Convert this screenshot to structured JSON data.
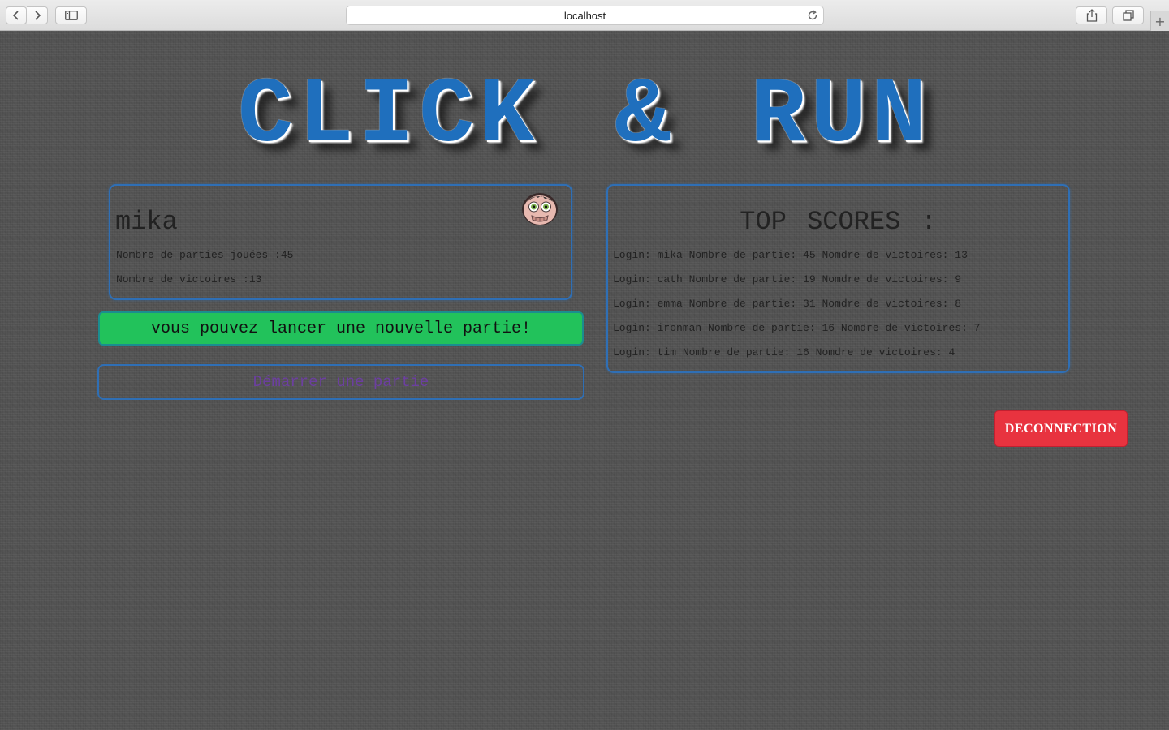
{
  "browser": {
    "url": "localhost",
    "icons": {
      "back": "chevron-left-icon",
      "forward": "chevron-right-icon",
      "sidebar": "sidebar-icon",
      "reload": "reload-icon",
      "share": "share-icon",
      "tabs": "tabs-overview-icon",
      "new_tab": "plus-icon"
    }
  },
  "page": {
    "title": "CLICK & RUN",
    "colors": {
      "title": "#1f6fbd",
      "panel_border": "#2f6fb5",
      "status_background": "#22c25b",
      "start_text": "#6c3fa0",
      "logout_background": "#e8333f"
    }
  },
  "profile": {
    "username": "mika",
    "games_played": "Nombre de parties jouées :45",
    "wins": "Nombre de victoires :13",
    "avatar_icon": "zombie-avatar-icon"
  },
  "status_message": "vous pouvez lancer une nouvelle partie!",
  "start_button_label": "Démarrer une partie",
  "top_scores": {
    "title": "TOP SCORES :",
    "rows": [
      "Login: mika Nombre de partie: 45 Nomdre de victoires: 13",
      "Login: cath Nombre de partie: 19 Nomdre de victoires: 9",
      "Login: emma Nombre de partie: 31 Nomdre de victoires: 8",
      "Login: ironman Nombre de partie: 16 Nomdre de victoires: 7",
      "Login: tim Nombre de partie: 16 Nomdre de victoires: 4"
    ]
  },
  "logout_button_label": "DECONNECTION"
}
